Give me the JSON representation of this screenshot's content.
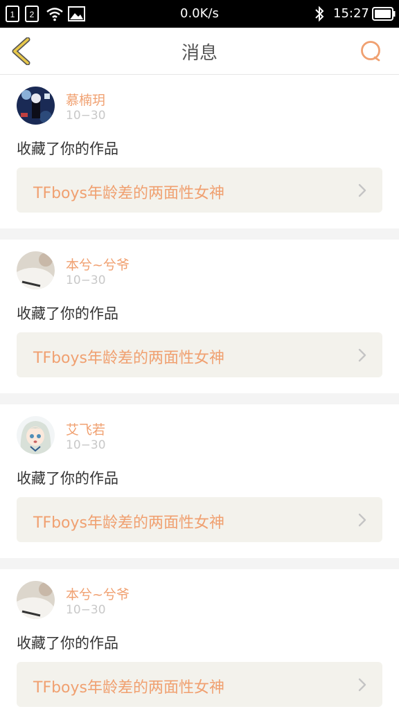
{
  "status_bar": {
    "network_speed": "0.0K/s",
    "time": "15:27",
    "sim1_label": "1",
    "sim2_label": "2",
    "icons": [
      "sim1-icon",
      "sim2-icon",
      "wifi-icon",
      "image-icon",
      "bluetooth-icon",
      "battery-icon"
    ]
  },
  "header": {
    "title": "消息",
    "back_icon": "chevron-left-icon",
    "search_icon": "search-icon"
  },
  "colors": {
    "accent": "#f0a070",
    "back_arrow": "#e8c84a",
    "link_bg": "#f3f2ec",
    "divider_bg": "#f4f4f4"
  },
  "notifications": [
    {
      "username": "慕楠玥",
      "date": "10−30",
      "action": "收藏了你的作品",
      "work_title": "TFboys年龄差的两面性女神",
      "avatar": "dark-art-avatar"
    },
    {
      "username": "本兮~兮爷",
      "date": "10−30",
      "action": "收藏了你的作品",
      "work_title": "TFboys年龄差的两面性女神",
      "avatar": "white-shirt-avatar"
    },
    {
      "username": "艾飞若",
      "date": "10−30",
      "action": "收藏了你的作品",
      "work_title": "TFboys年龄差的两面性女神",
      "avatar": "anime-girl-avatar"
    },
    {
      "username": "本兮~兮爷",
      "date": "10−30",
      "action": "收藏了你的作品",
      "work_title": "TFboys年龄差的两面性女神",
      "avatar": "white-shirt-avatar"
    }
  ]
}
